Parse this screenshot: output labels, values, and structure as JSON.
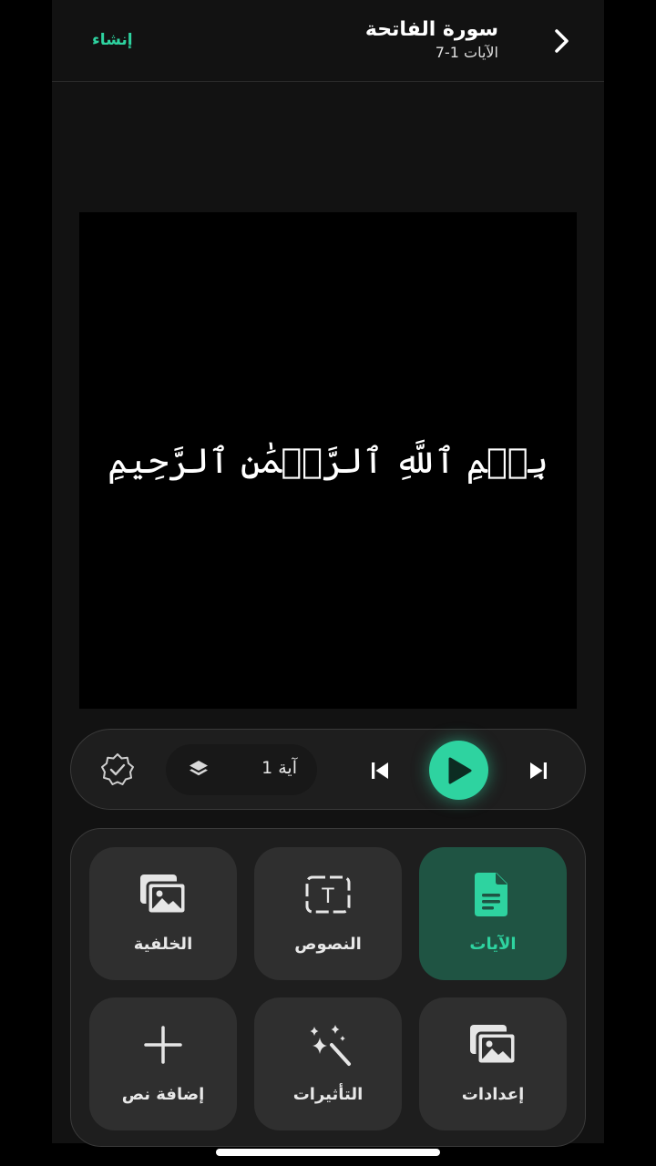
{
  "header": {
    "create_label": "إنشاء",
    "title": "سورة الفاتحة",
    "subtitle": "الآيات 1-7"
  },
  "preview": {
    "verse_text": "بِسۡمِ ٱللَّهِ ٱلرَّحۡمَٰنِ ٱلرَّحِيمِ"
  },
  "player": {
    "ayah_label": "آية 1"
  },
  "tools": {
    "verses": "الآيات",
    "texts": "النصوص",
    "background": "الخلفية",
    "settings": "إعدادات",
    "effects": "التأثيرات",
    "add_text": "إضافة نص"
  },
  "colors": {
    "accent": "#2ed3a0",
    "active_tile": "#1f5443",
    "tile": "#2f2f2f",
    "surface": "#121212"
  },
  "icons": {
    "back": "chevron-right-icon",
    "verified": "verified-badge-icon",
    "layers": "layers-icon",
    "previous": "skip-previous-icon",
    "play": "play-icon",
    "next": "skip-next-icon",
    "verses": "document-icon",
    "texts": "text-box-icon",
    "background": "images-icon",
    "settings": "images-icon",
    "effects": "magic-wand-icon",
    "add_text": "plus-icon"
  }
}
